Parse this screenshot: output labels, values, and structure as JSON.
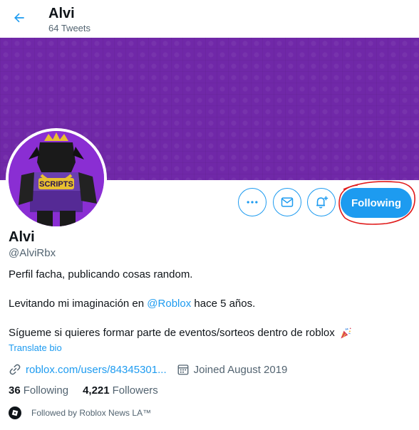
{
  "header": {
    "name": "Alvi",
    "tweet_count": "64 Tweets"
  },
  "actions": {
    "follow_label": "Following"
  },
  "profile": {
    "display_name": "Alvi",
    "handle": "@AlviRbx",
    "bio_line1": "Perfil facha, publicando cosas random.",
    "bio_line2_pre": "Levitando mi imaginación en ",
    "bio_line2_mention": "@Roblox",
    "bio_line2_post": " hace 5 años.",
    "bio_line3": "Sígueme si quieres formar parte de eventos/sorteos dentro de roblox",
    "translate_label": "Translate bio",
    "website": "roblox.com/users/84345301...",
    "joined": "Joined August 2019"
  },
  "stats": {
    "following_count": "36",
    "following_label": "Following",
    "followers_count": "4,221",
    "followers_label": "Followers"
  },
  "followed_by": "Followed by Roblox News LA™",
  "colors": {
    "accent": "#1d9bf0",
    "banner": "#7028a8",
    "annotation": "#e01b1b"
  },
  "avatar_text": "SCRIPTS"
}
